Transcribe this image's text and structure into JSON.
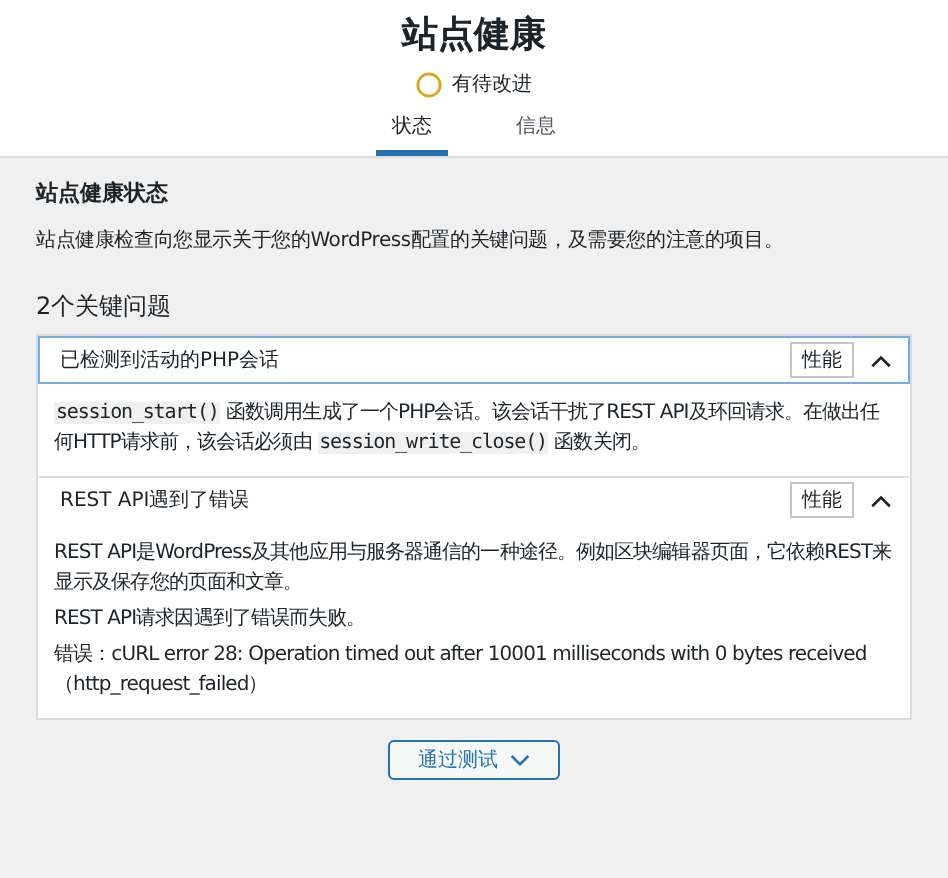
{
  "title": "站点健康",
  "status": {
    "label": "有待改进"
  },
  "tabs": [
    {
      "label": "状态",
      "selected": true
    },
    {
      "label": "信息",
      "selected": false
    }
  ],
  "section": {
    "heading": "站点健康状态",
    "description": "站点健康检查向您显示关于您的WordPress配置的关键问题，及需要您的注意的项目。"
  },
  "issues_heading": "2个关键问题",
  "issues": [
    {
      "title": "已检测到活动的PHP会话",
      "badge": "性能",
      "expanded": true,
      "focused": true,
      "paragraphs": [
        [
          {
            "kind": "code",
            "text": "session_start()"
          },
          {
            "kind": "text",
            "text": " 函数调用生成了一个PHP会话。该会话干扰了REST API及环回请求。在做出任何HTTP请求前，该会话必须由 "
          },
          {
            "kind": "code",
            "text": "session_write_close()"
          },
          {
            "kind": "text",
            "text": " 函数关闭。"
          }
        ]
      ]
    },
    {
      "title": "REST API遇到了错误",
      "badge": "性能",
      "expanded": true,
      "focused": false,
      "paragraphs": [
        [
          {
            "kind": "text",
            "text": "REST API是WordPress及其他应用与服务器通信的一种途径。例如区块编辑器页面，它依赖REST来显示及保存您的页面和文章。"
          }
        ],
        [
          {
            "kind": "text",
            "text": "REST API请求因遇到了错误而失败。"
          }
        ],
        [
          {
            "kind": "text",
            "text": "错误：cURL error 28: Operation timed out after 10001 milliseconds with 0 bytes received（http_request_failed）"
          }
        ]
      ]
    }
  ],
  "passed_button": {
    "label": "通过测试"
  }
}
